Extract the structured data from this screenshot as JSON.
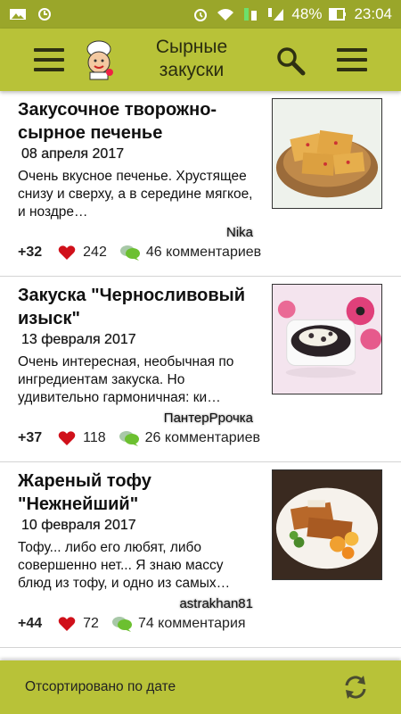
{
  "status_bar": {
    "battery": "48%",
    "time": "23:04"
  },
  "app_bar": {
    "title_line1": "Сырные",
    "title_line2": "закуски"
  },
  "items": [
    {
      "title": "Закусочное творожно-сырное печенье",
      "date": "08 апреля 2017",
      "description": "Очень вкусное печенье. Хрустящее снизу и сверху, а в середине мягкое, и ноздре…",
      "author": "Nika",
      "score": "+32",
      "likes": "242",
      "comments": "46 комментариев"
    },
    {
      "title": "Закуска \"Черносливовый изыск\"",
      "date": "13 февраля 2017",
      "description": "Очень интересная, необычная по ингредиентам закуска. Но удивительно гармоничная: ки…",
      "author": "ПантерРрочка",
      "score": "+37",
      "likes": "118",
      "comments": "26 комментариев"
    },
    {
      "title": "Жареный тофу \"Нежнейший\"",
      "date": "10 февраля 2017",
      "description": "Тофу... либо его любят, либо совершенно нет... Я знаю массу блюд из тофу, и одно из самых…",
      "author": "astrakhan81",
      "score": "+44",
      "likes": "72",
      "comments": "74 комментария"
    }
  ],
  "bottom_bar": {
    "sort_label": "Отсортировано по дате"
  },
  "colors": {
    "status_bar": "#9aa62a",
    "app_bar": "#b8c238",
    "heart": "#d0101a"
  }
}
